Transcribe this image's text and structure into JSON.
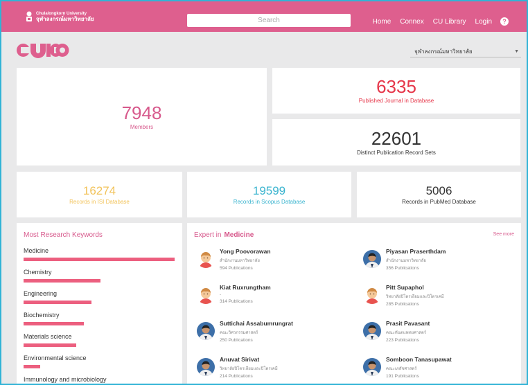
{
  "header": {
    "logo_en": "Chulalongkorn University",
    "logo_th": "จุฬาลงกรณ์มหาวิทยาลัย",
    "search_placeholder": "Search",
    "nav": [
      "Home",
      "Connex",
      "CU Library",
      "Login"
    ],
    "help_glyph": "?"
  },
  "brand": {
    "text": "CU ICO",
    "color": "#de5f8e"
  },
  "org_select": {
    "selected": "จุฬาลงกรณ์มหาวิทยาลัย"
  },
  "stats": {
    "members": {
      "value": "7948",
      "label": "Members"
    },
    "journals": {
      "value": "6335",
      "label": "Published Journal in Database"
    },
    "record_sets": {
      "value": "22601",
      "label": "Distinct Publication Record Sets"
    },
    "isi": {
      "value": "16274",
      "label": "Records in ISI Database"
    },
    "scopus": {
      "value": "19599",
      "label": "Records in Scopus Database"
    },
    "pubmed": {
      "value": "5006",
      "label": "Records in PubMed Database"
    }
  },
  "keywords": {
    "title": "Most Research Keywords",
    "items": [
      {
        "label": "Medicine",
        "level": 1.0
      },
      {
        "label": "Chemistry",
        "level": 0.51
      },
      {
        "label": "Engineering",
        "level": 0.45
      },
      {
        "label": "Biochemistry",
        "level": 0.4
      },
      {
        "label": "Materials science",
        "level": 0.35
      },
      {
        "label": "Environmental science",
        "level": 0.11
      },
      {
        "label": "Immunology and microbiology",
        "level": 0.0
      }
    ]
  },
  "experts": {
    "title": "Expert in",
    "field": "Medicine",
    "see_more": "See more",
    "people": [
      {
        "name": "Yong Poovorawan",
        "dept": "สำนักงานมหาวิทยาลัย",
        "pubs": "594 Publications",
        "avatar": "cartoon"
      },
      {
        "name": "Piyasan Praserthdam",
        "dept": "สำนักงานมหาวิทยาลัย",
        "pubs": "356 Publications",
        "avatar": "photo"
      },
      {
        "name": "Kiat Ruxrungtham",
        "dept": "-",
        "pubs": "314 Publications",
        "avatar": "cartoon"
      },
      {
        "name": "Pitt Supaphol",
        "dept": "วิทยาลัยปิโตรเลียมและปิโตรเคมี",
        "pubs": "285 Publications",
        "avatar": "cartoon"
      },
      {
        "name": "Suttichai Assabumrungrat",
        "dept": "คณะวิศวกรรมศาสตร์",
        "pubs": "250 Publications",
        "avatar": "photo"
      },
      {
        "name": "Prasit Pavasant",
        "dept": "คณะทันตแพทยศาสตร์",
        "pubs": "223 Publications",
        "avatar": "photo"
      },
      {
        "name": "Anuvat Sirivat",
        "dept": "วิทยาลัยปิโตรเลียมและปิโตรเคมี",
        "pubs": "214 Publications",
        "avatar": "photo"
      },
      {
        "name": "Somboon Tanasupawat",
        "dept": "คณะเภสัชศาสตร์",
        "pubs": "191 Publications",
        "avatar": "photo"
      }
    ]
  }
}
